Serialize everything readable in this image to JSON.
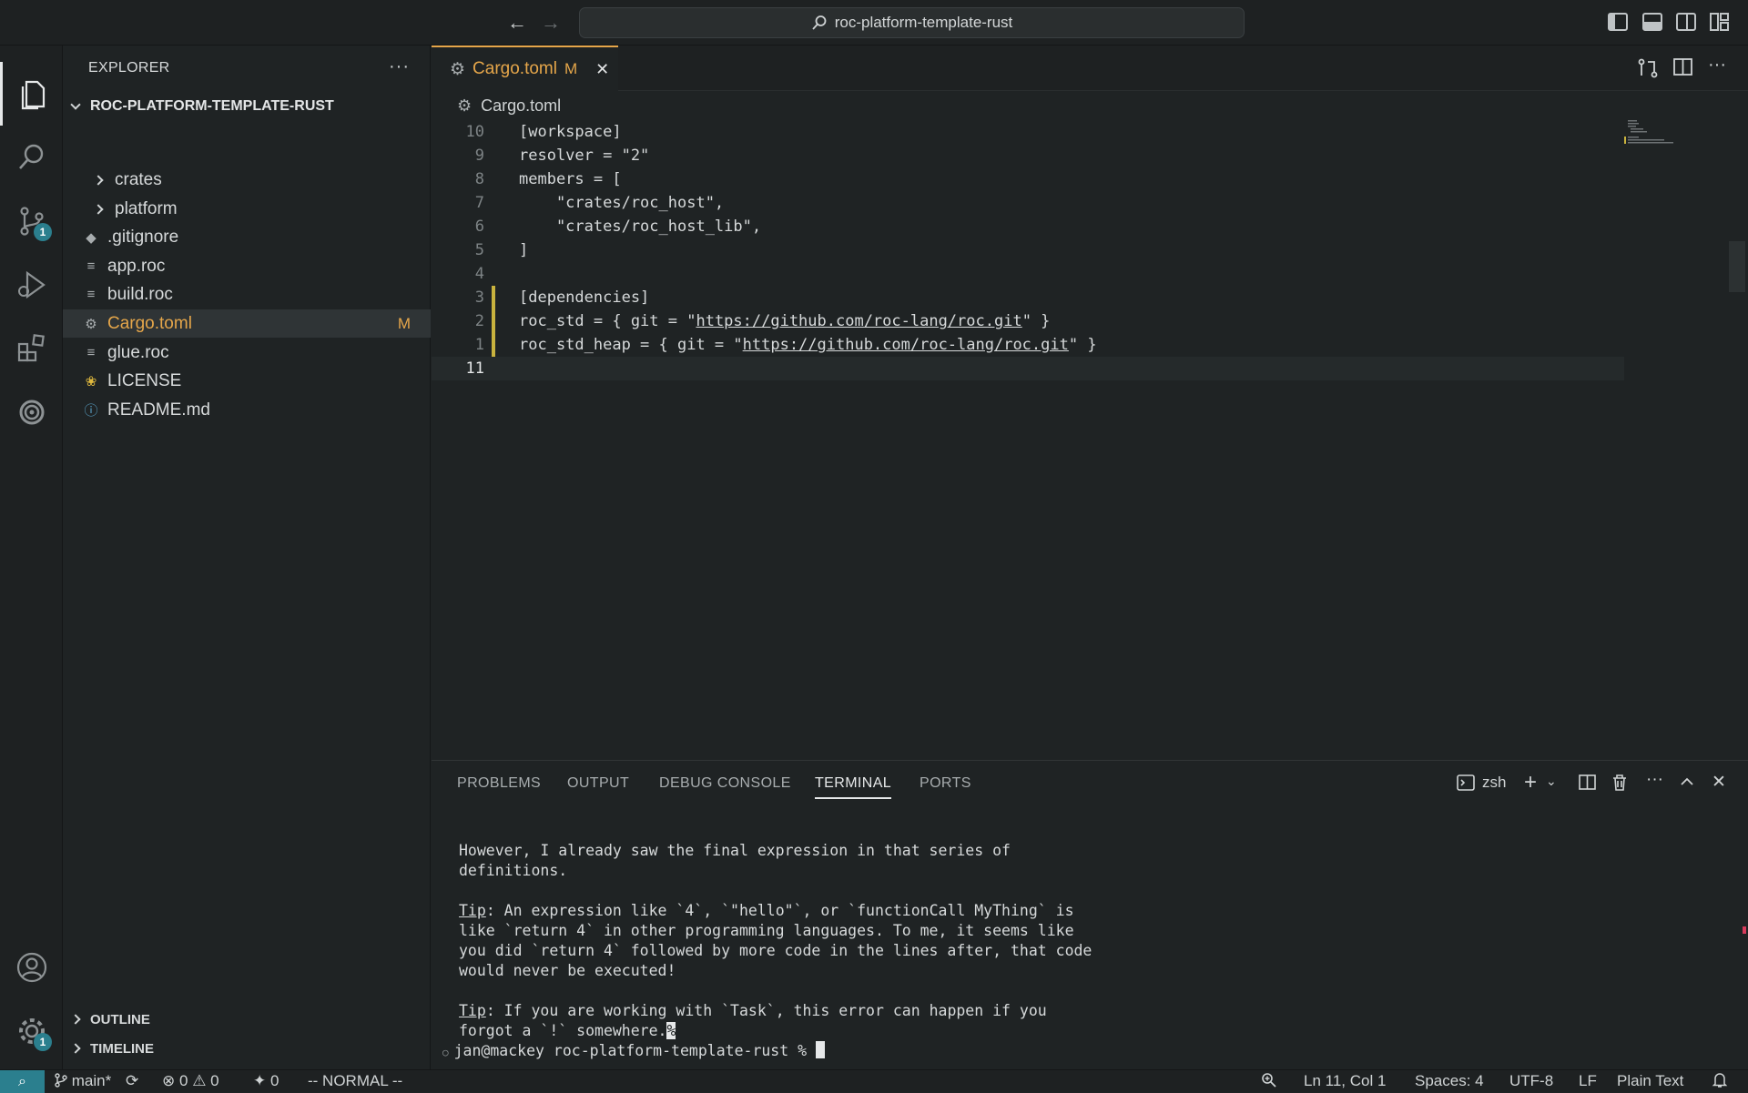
{
  "titlebar": {
    "search_text": "roc-platform-template-rust"
  },
  "activity": {
    "scm_badge": "1",
    "settings_badge": "1"
  },
  "explorer": {
    "title": "EXPLORER",
    "root": "ROC-PLATFORM-TEMPLATE-RUST",
    "items": [
      {
        "label": "crates",
        "icon": "chevron-right-icon"
      },
      {
        "label": "platform",
        "icon": "chevron-right-icon"
      },
      {
        "label": ".gitignore",
        "icon": "git-diamond-icon"
      },
      {
        "label": "app.roc",
        "icon": "lines-file-icon"
      },
      {
        "label": "build.roc",
        "icon": "lines-file-icon"
      },
      {
        "label": "Cargo.toml",
        "icon": "gear-icon",
        "status": "M"
      },
      {
        "label": "glue.roc",
        "icon": "lines-file-icon"
      },
      {
        "label": "LICENSE",
        "icon": "license-ribbon-icon"
      },
      {
        "label": "README.md",
        "icon": "info-icon"
      }
    ],
    "outline": "OUTLINE",
    "timeline": "TIMELINE"
  },
  "editor": {
    "tab_label": "Cargo.toml",
    "tab_status": "M",
    "breadcrumb": "Cargo.toml",
    "lines": [
      {
        "num": "10",
        "text": "[workspace]"
      },
      {
        "num": "9",
        "text": "resolver = \"2\""
      },
      {
        "num": "8",
        "text": "members = ["
      },
      {
        "num": "7",
        "text": "    \"crates/roc_host\","
      },
      {
        "num": "6",
        "text": "    \"crates/roc_host_lib\","
      },
      {
        "num": "5",
        "text": "]"
      },
      {
        "num": "4",
        "text": ""
      },
      {
        "num": "3",
        "text": "[dependencies]"
      },
      {
        "num": "2",
        "pre": "roc_std = { git = \"",
        "link": "https://github.com/roc-lang/roc.git",
        "post": "\" }"
      },
      {
        "num": "1",
        "pre": "roc_std_heap = { git = \"",
        "link": "https://github.com/roc-lang/roc.git",
        "post": "\" }"
      },
      {
        "num": "11",
        "text": ""
      }
    ]
  },
  "panel": {
    "tabs": [
      "PROBLEMS",
      "OUTPUT",
      "DEBUG CONSOLE",
      "TERMINAL",
      "PORTS"
    ],
    "active_tab": "TERMINAL",
    "shell": "zsh",
    "terminal": {
      "l1": "However, I already saw the final expression in that series of",
      "l2": "definitions.",
      "tip1_word": "Tip",
      "tip1_rest": ": An expression like `4`, `\"hello\"`, or `functionCall MyThing` is",
      "l4": "like `return 4` in other programming languages. To me, it seems like",
      "l5": "you did `return 4` followed by more code in the lines after, that code",
      "l6": "would never be executed!",
      "tip2_word": "Tip",
      "tip2_rest": ": If you are working with `Task`, this error can happen if you",
      "l8": "forgot a `!` somewhere.",
      "l8_mark": "%",
      "prompt": "jan@mackey roc-platform-template-rust % "
    }
  },
  "statusbar": {
    "branch": "main*",
    "errors": "0",
    "warnings": "0",
    "ports": "0",
    "vim_mode": "-- NORMAL --",
    "position": "Ln 11, Col 1",
    "spaces": "Spaces: 4",
    "encoding": "UTF-8",
    "eol": "LF",
    "language": "Plain Text"
  },
  "colors": {
    "accent_orange": "#e5a64a",
    "badge_teal": "#2b7f8e",
    "bg": "#1f2324"
  }
}
